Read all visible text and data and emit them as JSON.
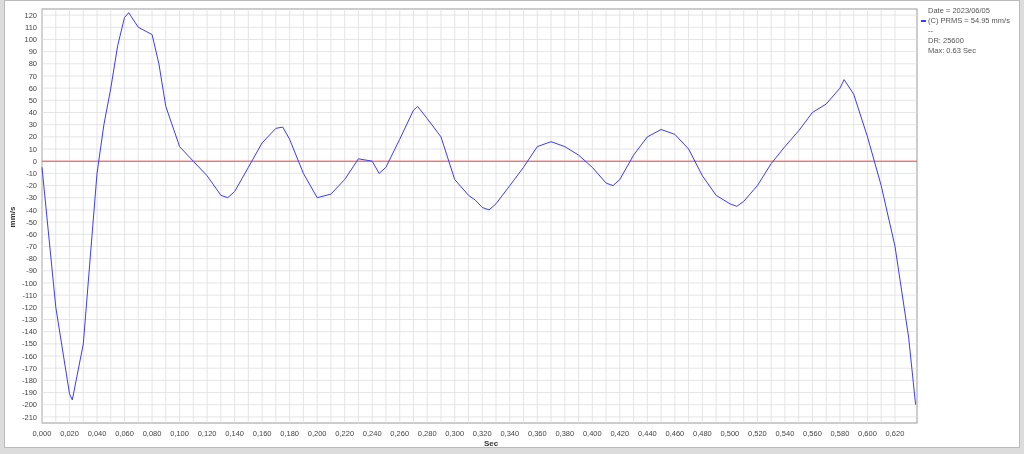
{
  "chart_data": {
    "type": "line",
    "xlabel": "Sec",
    "ylabel": "mm/s",
    "x": [
      0,
      0.01,
      0.02,
      0.022,
      0.03,
      0.04,
      0.045,
      0.05,
      0.055,
      0.06,
      0.063,
      0.07,
      0.08,
      0.085,
      0.09,
      0.1,
      0.11,
      0.12,
      0.13,
      0.135,
      0.14,
      0.15,
      0.16,
      0.17,
      0.175,
      0.18,
      0.19,
      0.2,
      0.21,
      0.22,
      0.23,
      0.24,
      0.245,
      0.25,
      0.26,
      0.27,
      0.273,
      0.28,
      0.29,
      0.3,
      0.31,
      0.315,
      0.32,
      0.325,
      0.33,
      0.34,
      0.35,
      0.36,
      0.37,
      0.38,
      0.39,
      0.4,
      0.41,
      0.415,
      0.42,
      0.43,
      0.44,
      0.45,
      0.46,
      0.47,
      0.48,
      0.49,
      0.5,
      0.505,
      0.51,
      0.52,
      0.53,
      0.54,
      0.55,
      0.56,
      0.57,
      0.58,
      0.583,
      0.59,
      0.6,
      0.61,
      0.62,
      0.63,
      0.635
    ],
    "series": [
      {
        "name": "(C) PRMS = 54.95 mm/s",
        "color": "#3b3bff",
        "values": [
          -5,
          -120,
          -191,
          -196,
          -150,
          -10,
          30,
          60,
          95,
          118,
          122,
          110,
          104,
          80,
          45,
          12,
          0,
          -12,
          -28,
          -30,
          -25,
          -5,
          15,
          27,
          28,
          18,
          -10,
          -30,
          -27,
          -15,
          2,
          0,
          -10,
          -5,
          18,
          42,
          45,
          35,
          20,
          -15,
          -28,
          -32,
          -38,
          -40,
          -35,
          -20,
          -5,
          12,
          16,
          12,
          5,
          -5,
          -18,
          -20,
          -15,
          5,
          20,
          26,
          22,
          10,
          -12,
          -28,
          -35,
          -37,
          -33,
          -20,
          -2,
          12,
          25,
          40,
          47,
          60,
          67,
          55,
          20,
          -20,
          -70,
          -145,
          -200
        ]
      }
    ],
    "xlim": [
      0,
      0.636
    ],
    "grid": true,
    "ylim": [
      -215,
      125
    ],
    "xticks": [
      {
        "value": 0,
        "label": "0,000"
      },
      {
        "value": 0.02,
        "label": "0,020"
      },
      {
        "value": 0.04,
        "label": "0,040"
      },
      {
        "value": 0.06,
        "label": "0,060"
      },
      {
        "value": 0.08,
        "label": "0,080"
      },
      {
        "value": 0.1,
        "label": "0,100"
      },
      {
        "value": 0.12,
        "label": "0,120"
      },
      {
        "value": 0.14,
        "label": "0,140"
      },
      {
        "value": 0.16,
        "label": "0,160"
      },
      {
        "value": 0.18,
        "label": "0,180"
      },
      {
        "value": 0.2,
        "label": "0,200"
      },
      {
        "value": 0.22,
        "label": "0,220"
      },
      {
        "value": 0.24,
        "label": "0,240"
      },
      {
        "value": 0.26,
        "label": "0,260"
      },
      {
        "value": 0.28,
        "label": "0,280"
      },
      {
        "value": 0.3,
        "label": "0,300"
      },
      {
        "value": 0.32,
        "label": "0,320"
      },
      {
        "value": 0.34,
        "label": "0,340"
      },
      {
        "value": 0.36,
        "label": "0,360"
      },
      {
        "value": 0.38,
        "label": "0,380"
      },
      {
        "value": 0.4,
        "label": "0,400"
      },
      {
        "value": 0.42,
        "label": "0,420"
      },
      {
        "value": 0.44,
        "label": "0,440"
      },
      {
        "value": 0.46,
        "label": "0,460"
      },
      {
        "value": 0.48,
        "label": "0,480"
      },
      {
        "value": 0.5,
        "label": "0,500"
      },
      {
        "value": 0.52,
        "label": "0,520"
      },
      {
        "value": 0.54,
        "label": "0,540"
      },
      {
        "value": 0.56,
        "label": "0,560"
      },
      {
        "value": 0.58,
        "label": "0,580"
      },
      {
        "value": 0.6,
        "label": "0,600"
      },
      {
        "value": 0.62,
        "label": "0,620"
      }
    ],
    "yticks": [
      120,
      110,
      100,
      90,
      80,
      70,
      60,
      50,
      40,
      30,
      20,
      10,
      0,
      -10,
      -20,
      -30,
      -40,
      -50,
      -60,
      -70,
      -80,
      -90,
      -100,
      -110,
      -120,
      -130,
      -140,
      -150,
      -160,
      -170,
      -180,
      -190,
      -200,
      -210
    ],
    "ref_lines": [
      {
        "axis": "y",
        "value": 0,
        "color": "#ff4040"
      }
    ]
  },
  "legend": {
    "header": "Date = 2023/06/05",
    "lines": [
      "--",
      "DR: 25600",
      "Max: 0.63 Sec"
    ]
  }
}
